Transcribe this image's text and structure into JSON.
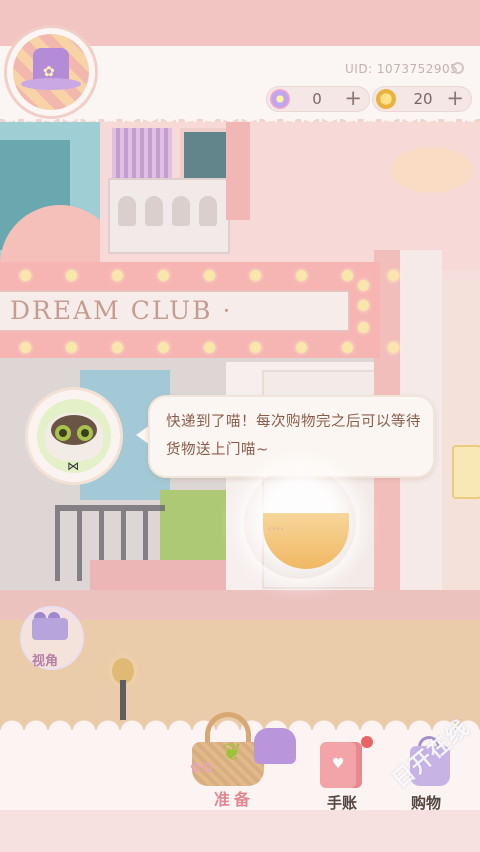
{
  "header": {
    "uid_text": "UID: 1073752905",
    "currency": [
      {
        "icon": "flower-currency-icon",
        "value": "0",
        "plus": "+"
      },
      {
        "icon": "coin-icon",
        "value": "20",
        "plus": "+"
      }
    ]
  },
  "scene": {
    "sign_text": "DREAM CLUB ·"
  },
  "npc": {
    "name_icon": "cat-npc-avatar",
    "dialogue": "快递到了喵！每次购物完之后可以等待货物送上门喵~"
  },
  "view_button": {
    "label": "视角"
  },
  "dock": {
    "items": [
      {
        "label": "准备",
        "icon": "basket-icon"
      },
      {
        "label": "手账",
        "icon": "notebook-icon"
      },
      {
        "label": "购物",
        "icon": "shopping-bag-icon"
      }
    ]
  },
  "watermark": "日开在线",
  "colors": {
    "accent_pink": "#f2c5c3",
    "dialogue_text": "#8a5d4b",
    "prep_label": "#e48590"
  }
}
